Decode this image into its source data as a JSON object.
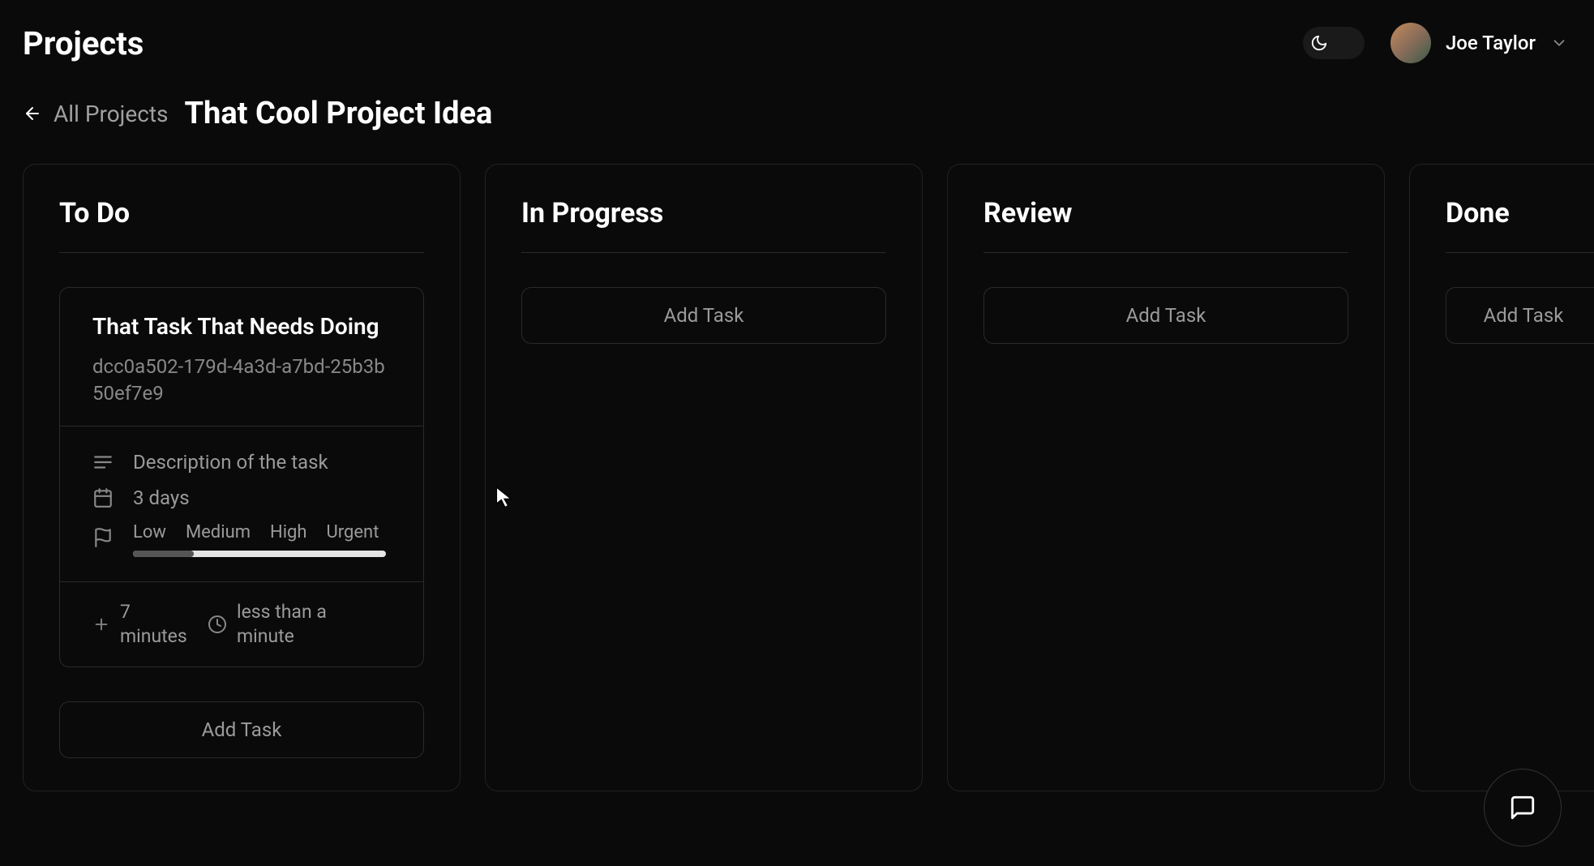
{
  "header": {
    "page_title": "Projects",
    "username": "Joe Taylor"
  },
  "breadcrumb": {
    "back_label": "All Projects",
    "project_title": "That Cool Project Idea"
  },
  "columns": [
    {
      "title": "To Do",
      "add_label": "Add Task"
    },
    {
      "title": "In Progress",
      "add_label": "Add Task"
    },
    {
      "title": "Review",
      "add_label": "Add Task"
    },
    {
      "title": "Done",
      "add_label": "Add Task"
    }
  ],
  "task": {
    "title": "That Task That Needs Doing",
    "id": "dcc0a502-179d-4a3d-a7bd-25b3b50ef7e9",
    "description": "Description of the task",
    "due": "3 days",
    "priority_labels": [
      "Low",
      "Medium",
      "High",
      "Urgent"
    ],
    "created_ago": "7 minutes",
    "updated_ago": "less than a minute"
  }
}
